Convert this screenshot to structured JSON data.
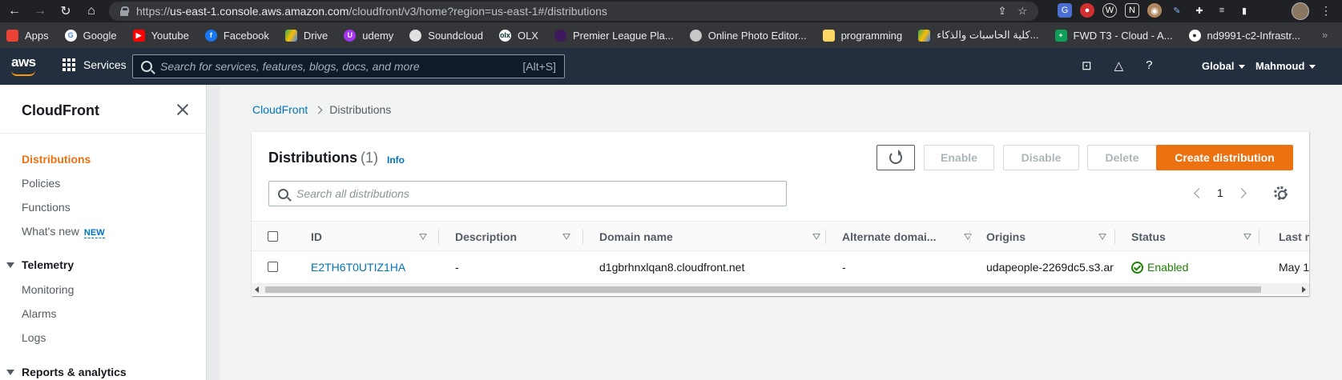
{
  "browser": {
    "url_prefix": "https://",
    "url_host": "us-east-1.console.aws.amazon.com",
    "url_path": "/cloudfront/v3/home?region=us-east-1#/distributions",
    "bookmarks": [
      {
        "label": "Apps",
        "icon": "apps-grid-icon",
        "color": "#ea4335"
      },
      {
        "label": "Google",
        "icon": "google-icon",
        "color": "#4285f4"
      },
      {
        "label": "Youtube",
        "icon": "youtube-icon",
        "color": "#ff0000"
      },
      {
        "label": "Facebook",
        "icon": "facebook-icon",
        "color": "#1877f2"
      },
      {
        "label": "Drive",
        "icon": "drive-icon",
        "color": "#34a853"
      },
      {
        "label": "udemy",
        "icon": "udemy-icon",
        "color": "#a435f0"
      },
      {
        "label": "Soundcloud",
        "icon": "soundcloud-icon",
        "color": "#888888"
      },
      {
        "label": "OLX",
        "icon": "olx-icon",
        "color": "#002f34"
      },
      {
        "label": "Premier League Pla...",
        "icon": "premier-league-icon",
        "color": "#3d195b"
      },
      {
        "label": "Online Photo Editor...",
        "icon": "photo-editor-icon",
        "color": "#aaaaaa"
      },
      {
        "label": "programming",
        "icon": "folder-icon",
        "color": "#fdd663"
      },
      {
        "label": "كلية الحاسبات والذكاء...",
        "icon": "drive-icon",
        "color": "#34a853"
      },
      {
        "label": "FWD T3 - Cloud - A...",
        "icon": "sheets-icon",
        "color": "#0f9d58"
      },
      {
        "label": "nd9991-c2-Infrastr...",
        "icon": "github-icon",
        "color": "#24292e"
      }
    ],
    "bookmarks_more": "»"
  },
  "aws": {
    "logo": "aws",
    "services_label": "Services",
    "search_placeholder": "Search for services, features, blogs, docs, and more",
    "search_shortcut": "[Alt+S]",
    "region": "Global",
    "user": "Mahmoud"
  },
  "sidebar": {
    "title": "CloudFront",
    "items": [
      {
        "label": "Distributions",
        "active": true
      },
      {
        "label": "Policies"
      },
      {
        "label": "Functions"
      },
      {
        "label": "What's new",
        "badge": "NEW"
      }
    ],
    "sections": [
      {
        "label": "Telemetry",
        "items": [
          "Monitoring",
          "Alarms",
          "Logs"
        ]
      },
      {
        "label": "Reports & analytics"
      }
    ]
  },
  "breadcrumb": {
    "root": "CloudFront",
    "current": "Distributions"
  },
  "panel": {
    "title": "Distributions",
    "count": "(1)",
    "info": "Info",
    "buttons": {
      "enable": "Enable",
      "disable": "Disable",
      "delete": "Delete",
      "create": "Create distribution"
    },
    "search_placeholder": "Search all distributions",
    "page": "1"
  },
  "table": {
    "columns": [
      "ID",
      "Description",
      "Domain name",
      "Alternate domai...",
      "Origins",
      "Status",
      "Last m"
    ],
    "rows": [
      {
        "id": "E2TH6T0UTIZ1HA",
        "description": "-",
        "domain": "d1gbrhnxlqan8.cloudfront.net",
        "alternate": "-",
        "origins": "udapeople-2269dc5.s3.ar",
        "status": "Enabled",
        "last_modified": "May 1"
      }
    ]
  },
  "colors": {
    "accent": "#ec7211",
    "link": "#0073bb",
    "header": "#232f3e",
    "success": "#1d8102"
  }
}
